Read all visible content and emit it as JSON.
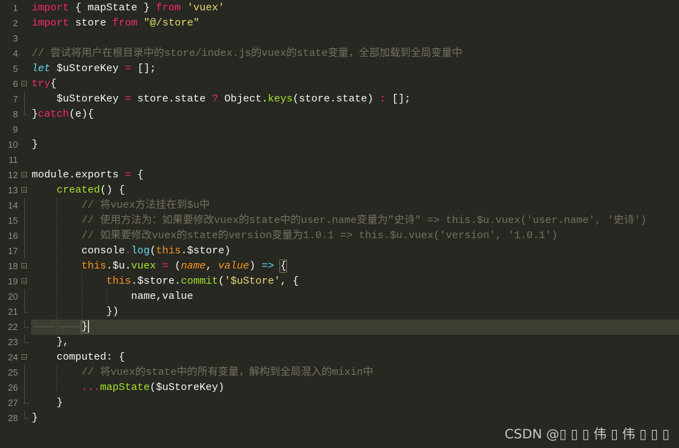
{
  "editor": {
    "theme": {
      "background": "#272822",
      "keyword": "#f92672",
      "string": "#e6db74",
      "comment": "#75715e",
      "function": "#a6e22e",
      "this": "#fd971f",
      "storage": "#66d9ef",
      "active_line": "#3e3d32"
    },
    "active_line": 22,
    "lines": [
      {
        "n": "1",
        "tokens": [
          [
            "k",
            "import"
          ],
          [
            "w",
            " { mapState } "
          ],
          [
            "k",
            "from"
          ],
          [
            "w",
            " "
          ],
          [
            "s",
            "'vuex'"
          ]
        ]
      },
      {
        "n": "2",
        "tokens": [
          [
            "k",
            "import"
          ],
          [
            "w",
            " store "
          ],
          [
            "k",
            "from"
          ],
          [
            "w",
            " "
          ],
          [
            "s",
            "\"@/store\""
          ]
        ]
      },
      {
        "n": "3",
        "tokens": []
      },
      {
        "n": "4",
        "tokens": [
          [
            "c",
            "// 尝试将用户在根目录中的store/index.js的vuex的state变量，全部加载到全局变量中"
          ]
        ]
      },
      {
        "n": "5",
        "tokens": [
          [
            "bi",
            "let"
          ],
          [
            "w",
            " $uStoreKey "
          ],
          [
            "k",
            "="
          ],
          [
            "w",
            " [];"
          ]
        ]
      },
      {
        "n": "6",
        "fold": "open",
        "tokens": [
          [
            "k",
            "try"
          ],
          [
            "w",
            "{"
          ]
        ]
      },
      {
        "n": "7",
        "tokens": [
          [
            "w",
            "    $uStoreKey "
          ],
          [
            "k",
            "="
          ],
          [
            "w",
            " store.state "
          ],
          [
            "k",
            "?"
          ],
          [
            "w",
            " Object."
          ],
          [
            "f",
            "keys"
          ],
          [
            "w",
            "(store.state) "
          ],
          [
            "k",
            ":"
          ],
          [
            "w",
            " [];"
          ]
        ]
      },
      {
        "n": "8",
        "fold": "end",
        "tokens": [
          [
            "w",
            "}"
          ],
          [
            "k",
            "catch"
          ],
          [
            "w",
            "(e){"
          ]
        ]
      },
      {
        "n": "9",
        "tokens": []
      },
      {
        "n": "10",
        "tokens": [
          [
            "w",
            "}"
          ]
        ]
      },
      {
        "n": "11",
        "tokens": []
      },
      {
        "n": "12",
        "fold": "open",
        "tokens": [
          [
            "w",
            "module.exports "
          ],
          [
            "k",
            "="
          ],
          [
            "w",
            " {"
          ]
        ]
      },
      {
        "n": "13",
        "fold": "open",
        "tokens": [
          [
            "w",
            "    "
          ],
          [
            "f",
            "created"
          ],
          [
            "w",
            "() {"
          ]
        ]
      },
      {
        "n": "14",
        "tokens": [
          [
            "w",
            "        "
          ],
          [
            "c",
            "// 将vuex方法挂在到$u中"
          ]
        ]
      },
      {
        "n": "15",
        "tokens": [
          [
            "w",
            "        "
          ],
          [
            "c",
            "// 使用方法为：如果要修改vuex的state中的user.name变量为\"史诗\" => this.$u.vuex('user.name', '史诗')"
          ]
        ]
      },
      {
        "n": "16",
        "tokens": [
          [
            "w",
            "        "
          ],
          [
            "c",
            "// 如果要修改vuex的state的version变量为1.0.1 => this.$u.vuex('version', '1.0.1')"
          ]
        ]
      },
      {
        "n": "17",
        "tokens": [
          [
            "w",
            "        console"
          ],
          [
            "k",
            "."
          ],
          [
            "b",
            "log"
          ],
          [
            "w",
            "("
          ],
          [
            "t",
            "this"
          ],
          [
            "w",
            ".$store)"
          ]
        ]
      },
      {
        "n": "18",
        "fold": "open",
        "tokens": [
          [
            "w",
            "        "
          ],
          [
            "t",
            "this"
          ],
          [
            "w",
            ".$u."
          ],
          [
            "f",
            "vuex"
          ],
          [
            "w",
            " "
          ],
          [
            "k",
            "="
          ],
          [
            "w",
            " ("
          ],
          [
            "i",
            "name"
          ],
          [
            "w",
            ", "
          ],
          [
            "i",
            "value"
          ],
          [
            "w",
            ") "
          ],
          [
            "b",
            "=>"
          ],
          [
            "w",
            " "
          ],
          [
            "hl",
            "{"
          ]
        ]
      },
      {
        "n": "19",
        "fold": "open",
        "tokens": [
          [
            "w",
            "            "
          ],
          [
            "t",
            "this"
          ],
          [
            "w",
            ".$store."
          ],
          [
            "f",
            "commit"
          ],
          [
            "w",
            "("
          ],
          [
            "s",
            "'$uStore'"
          ],
          [
            "w",
            ", {"
          ]
        ]
      },
      {
        "n": "20",
        "tokens": [
          [
            "w",
            "                name,value"
          ]
        ]
      },
      {
        "n": "21",
        "fold": "end",
        "tokens": [
          [
            "w",
            "            })"
          ]
        ]
      },
      {
        "n": "22",
        "fold": "end",
        "tokens": [
          [
            "dash",
            ""
          ],
          [
            "hlc",
            "}"
          ]
        ]
      },
      {
        "n": "23",
        "fold": "end",
        "tokens": [
          [
            "w",
            "    },"
          ]
        ]
      },
      {
        "n": "24",
        "fold": "open",
        "tokens": [
          [
            "w",
            "    computed: {"
          ]
        ]
      },
      {
        "n": "25",
        "tokens": [
          [
            "w",
            "        "
          ],
          [
            "c",
            "// 将vuex的state中的所有变量，解构到全局混入的mixin中"
          ]
        ]
      },
      {
        "n": "26",
        "tokens": [
          [
            "w",
            "        "
          ],
          [
            "k",
            "..."
          ],
          [
            "f",
            "mapState"
          ],
          [
            "w",
            "($uStoreKey)"
          ]
        ]
      },
      {
        "n": "27",
        "fold": "end",
        "tokens": [
          [
            "w",
            "    }"
          ]
        ]
      },
      {
        "n": "28",
        "fold": "end",
        "tokens": [
          [
            "w",
            "}"
          ]
        ]
      }
    ]
  },
  "watermark": {
    "text": "CSDN @▯ ▯ ▯ 伟 ▯ 伟 ▯ ▯ ▯"
  }
}
